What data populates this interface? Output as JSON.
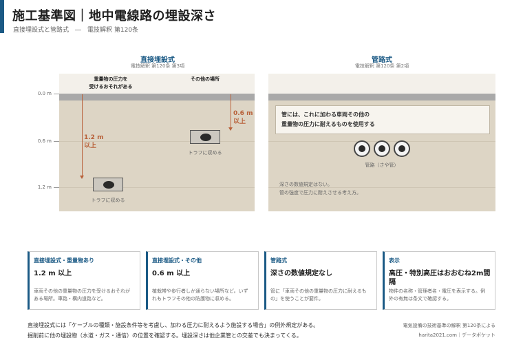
{
  "header": {
    "title": "施工基準図｜地中電線路の埋設深さ",
    "subtitle": "直接埋設式と管路式　―　電技解釈 第120条"
  },
  "left_panel": {
    "title": "直接埋設式",
    "subtitle": "電技解釈 第120条 第3項",
    "depth_ticks": [
      "0.0 m",
      "0.6 m",
      "1.2 m"
    ],
    "context_heavy": [
      "重量物の圧力を",
      "受けるおそれがある"
    ],
    "context_other": "その他の場所",
    "dim_heavy": [
      "1.2 m",
      "以上"
    ],
    "dim_other": [
      "0.6 m",
      "以上"
    ],
    "trough_label_1": "トラフに収める",
    "trough_label_2": "トラフに収める"
  },
  "right_panel": {
    "title": "管路式",
    "subtitle": "電技解釈 第120条 第2項",
    "note": [
      "管には、これに加わる車両その他の",
      "重量物の圧力に耐えるものを使用する"
    ],
    "pipe_label": "管路（さや管）",
    "footnote": [
      "深さの数値規定はない。",
      "管の強度で圧力に耐えさせる考え方。"
    ]
  },
  "cards": [
    {
      "head": "直接埋設式・重量物あり",
      "value": "1.2 m 以上",
      "desc": [
        "車両その他の重量物の圧力を受けるおそれが",
        "ある場所。車路・構内道路など。"
      ]
    },
    {
      "head": "直接埋設式・その他",
      "value": "0.6 m 以上",
      "desc": [
        "植栽帯や歩行者しか通らない場所など。いず",
        "れもトラフその他の防護物に収める。"
      ]
    },
    {
      "head": "管路式",
      "value": "深さの数値規定なし",
      "desc": [
        "管に「車両その他の重量物の圧力に耐えるも",
        "の」を使うことが要件。"
      ]
    },
    {
      "head": "表示",
      "value": "高圧・特別高圧はおおむね2m間隔",
      "desc": [
        "物件の名称・管理者名・電圧を表示する。例",
        "外の有無は条文で確認する。"
      ]
    }
  ],
  "footer": {
    "line1": "直接埋設式には「ケーブルの種類・施設条件等を考慮し、加わる圧力に耐えるよう施設する場合」の例外規定がある。",
    "line2": "掘削前に他の埋設物（水道・ガス・通信）の位置を確認する。埋設深さは他企業管との交差でも決まってくる。",
    "source1": "電気設備の技術基準の解釈 第120条による",
    "source2": "harita2021.com｜データポケット"
  },
  "colors": {
    "accent": "#1b5a85",
    "dimension": "#b8613a",
    "soil": "#ddd5c5",
    "surface": "#a9a9a9"
  }
}
